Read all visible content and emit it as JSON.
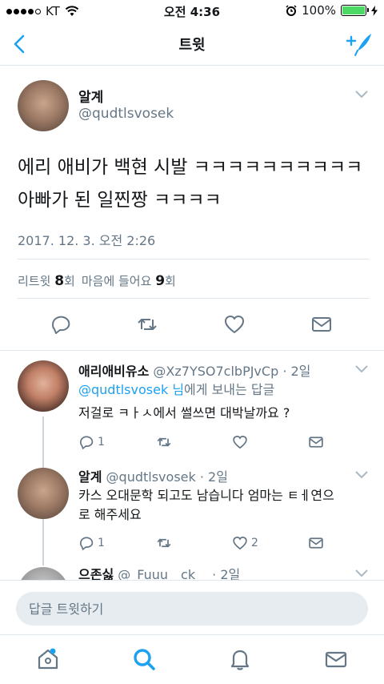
{
  "status_bar": {
    "carrier": "KT",
    "time": "오전 4:36",
    "battery": "100%",
    "battery_level": 1.0
  },
  "nav": {
    "title": "트윗",
    "back_icon": "chevron-left-icon",
    "compose_icon": "compose-tweet-icon"
  },
  "main_tweet": {
    "name": "알계",
    "handle": "@qudtlsvosek",
    "text": "에리 애비가 백현 시발 ㅋㅋㅋㅋㅋㅋㅋㅋㅋㅋ아빠가 된 일찐짱 ㅋㅋㅋㅋ",
    "date": "2017. 12. 3. 오전 2:26",
    "retweets_label": "리트윗",
    "retweets_count": "8",
    "retweets_unit": "회",
    "likes_label": "마음에 들어요",
    "likes_count": "9",
    "likes_unit": "회"
  },
  "replies": [
    {
      "name": "애리애비유소",
      "handle": "@Xz7YSO7clbPJvCp",
      "time": "· 2일",
      "to_handle": "@qudtlsvosek",
      "to_suffix_1": "님",
      "to_suffix_2": "에게 보내는 답글",
      "text": "저걸로 ㅋㅏㅅ에서 썰쓰면 대박날까요 ?",
      "reply_count": "1",
      "like_count": ""
    },
    {
      "name": "알계",
      "handle": "@qudtlsvosek",
      "time": "· 2일",
      "text_line1": "카스 오대문학 되고도 남습니다 엄마는 ㅌㅔ연으",
      "text_line2": "로 해주세요",
      "reply_count": "1",
      "like_count": "2"
    },
    {
      "name": "으존싫",
      "handle": "@_Fuuu__ck__",
      "time": "· 2일"
    }
  ],
  "reply_bar": {
    "placeholder": "답글 트윗하기"
  },
  "tabs": {
    "home_icon": "home-icon",
    "search_icon": "search-icon",
    "notifications_icon": "bell-icon",
    "messages_icon": "envelope-icon",
    "active_color": "#1da1f2",
    "inactive_color": "#657786"
  }
}
